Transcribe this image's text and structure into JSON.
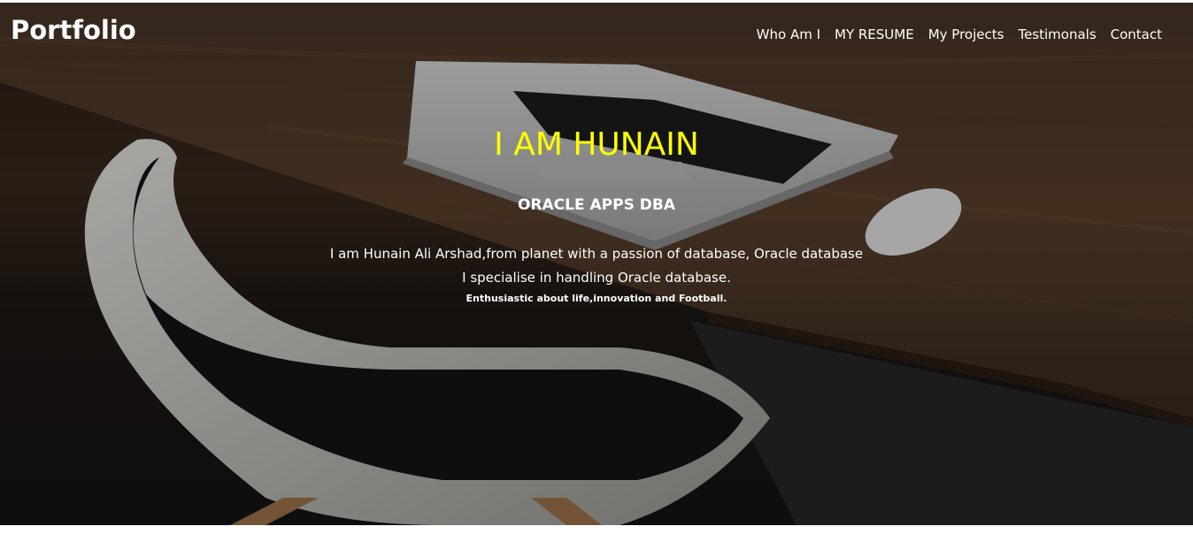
{
  "header": {
    "brand": "Portfolio",
    "nav": [
      {
        "label": "Who Am I"
      },
      {
        "label": "MY RESUME"
      },
      {
        "label": "My Projects"
      },
      {
        "label": "Testimonals"
      },
      {
        "label": "Contact"
      }
    ]
  },
  "hero": {
    "title": "I AM HUNAIN",
    "subtitle": "ORACLE APPS DBA",
    "line1": "I am Hunain Ali Arshad,from planet with a passion of database, Oracle database",
    "line2": "I specialise in handling Oracle database.",
    "line3": "Enthusiastic about life,innovation and Football.",
    "background_image": "desk-laptop-chair-photo",
    "title_color": "#ffff00"
  }
}
